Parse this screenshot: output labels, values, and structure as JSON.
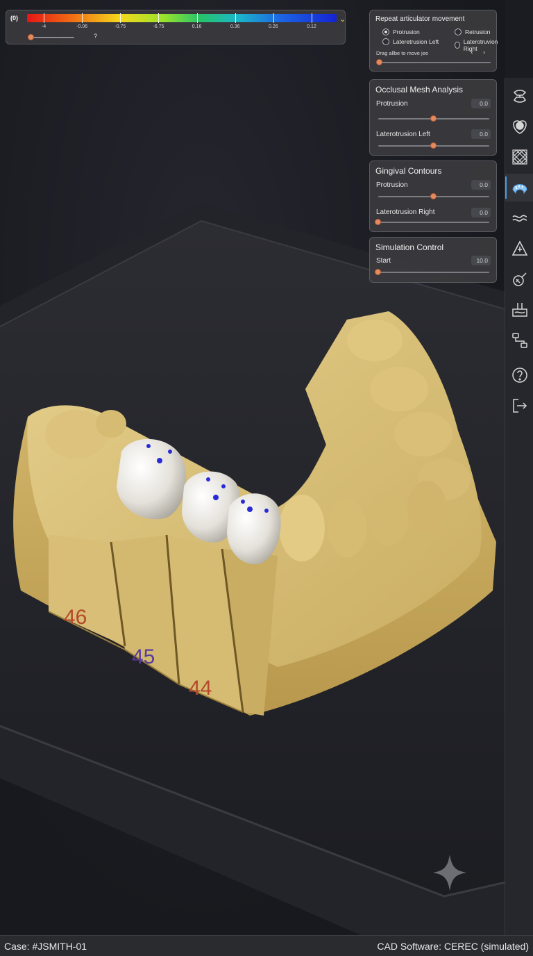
{
  "colorbar": {
    "toggle_label": "(0)",
    "ticks": [
      "-4",
      "-0.06",
      "-0.75",
      "-6.75",
      "0.16",
      "0.36",
      "0.26",
      "0.12"
    ],
    "help_label": "?",
    "slider_value": 0.0
  },
  "articulator": {
    "title": "Repeat articulator movement",
    "options": [
      {
        "label": "Protrusion",
        "selected": true
      },
      {
        "label": "Retrusion",
        "selected": false
      },
      {
        "label": "Lateretrusion Left",
        "selected": false
      },
      {
        "label": "Laterotruvion Right",
        "selected": false
      }
    ],
    "drag_hint": "Drag allbe to move jee",
    "nav": "‹ ›",
    "slider_value": 0.0
  },
  "occlusal": {
    "title": "Occlusal Mesh Analysis",
    "rows": [
      {
        "label": "Protrusion",
        "value": "0.0",
        "slider": 0.5
      },
      {
        "label": "Laterotrusion Left",
        "value": "0.0",
        "slider": 0.5
      }
    ]
  },
  "gingival": {
    "title": "Gingival Contours",
    "rows": [
      {
        "label": "Protrusion",
        "value": "0.0",
        "slider": 0.5
      },
      {
        "label": "Laterotrusion Right",
        "value": "0.0",
        "slider": 0.0
      }
    ]
  },
  "simulation": {
    "title": "Simulation Control",
    "rows": [
      {
        "label": "Start",
        "value": "10.0",
        "slider": 0.0
      }
    ]
  },
  "model": {
    "tooth_numbers": [
      "46",
      "45",
      "44"
    ]
  },
  "toolbar": {
    "tools": [
      "articulator-icon",
      "tooth-icon",
      "mesh-grid-icon",
      "arch-icon",
      "wave-icon",
      "triangle-icon",
      "brush-icon",
      "mill-icon",
      "workflow-icon",
      "help-icon",
      "exit-icon"
    ],
    "active": "arch-icon"
  },
  "status": {
    "case": "Case: #JSMITH-01",
    "software": "CAD Software: CEREC (simulated)"
  },
  "colors": {
    "accent_thumb": "#e58a5c",
    "active_tool": "#4a9de0",
    "stone": "#d9c07a"
  }
}
